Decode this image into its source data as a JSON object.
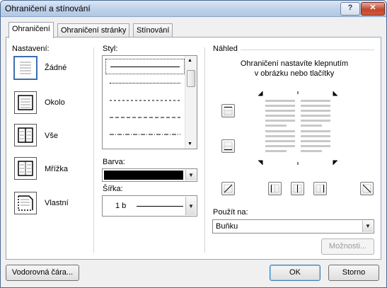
{
  "window": {
    "title": "Ohraničení a stínování"
  },
  "titlebar": {
    "help_label": "?",
    "close_label": "✕"
  },
  "tabs": [
    {
      "label": "Ohraničení",
      "active": true
    },
    {
      "label": "Ohraničení stránky",
      "active": false
    },
    {
      "label": "Stínování",
      "active": false
    }
  ],
  "settings": {
    "heading": "Nastavení:",
    "items": [
      {
        "label": "Žádné",
        "icon": "border-none-icon",
        "selected": true
      },
      {
        "label": "Okolo",
        "icon": "border-box-icon",
        "selected": false
      },
      {
        "label": "Vše",
        "icon": "border-all-icon",
        "selected": false
      },
      {
        "label": "Mřížka",
        "icon": "border-grid-icon",
        "selected": false
      },
      {
        "label": "Vlastní",
        "icon": "border-custom-icon",
        "selected": false
      }
    ]
  },
  "style": {
    "heading": "Styl:",
    "options": [
      "solid",
      "dotted",
      "dashed",
      "dashed-long",
      "dash-dot"
    ],
    "selected_index": 0
  },
  "color": {
    "heading": "Barva:",
    "value": "#000000"
  },
  "width": {
    "heading": "Šířka:",
    "value": "1 b"
  },
  "preview": {
    "heading": "Náhled",
    "hint_line1": "Ohraničení nastavíte klepnutím",
    "hint_line2": "v obrázku nebo tlačítky"
  },
  "apply": {
    "heading": "Použít na:",
    "value": "Buňku"
  },
  "buttons": {
    "options": "Možnosti...",
    "horizontal_line": "Vodorovná čára...",
    "ok": "OK",
    "cancel": "Storno"
  }
}
